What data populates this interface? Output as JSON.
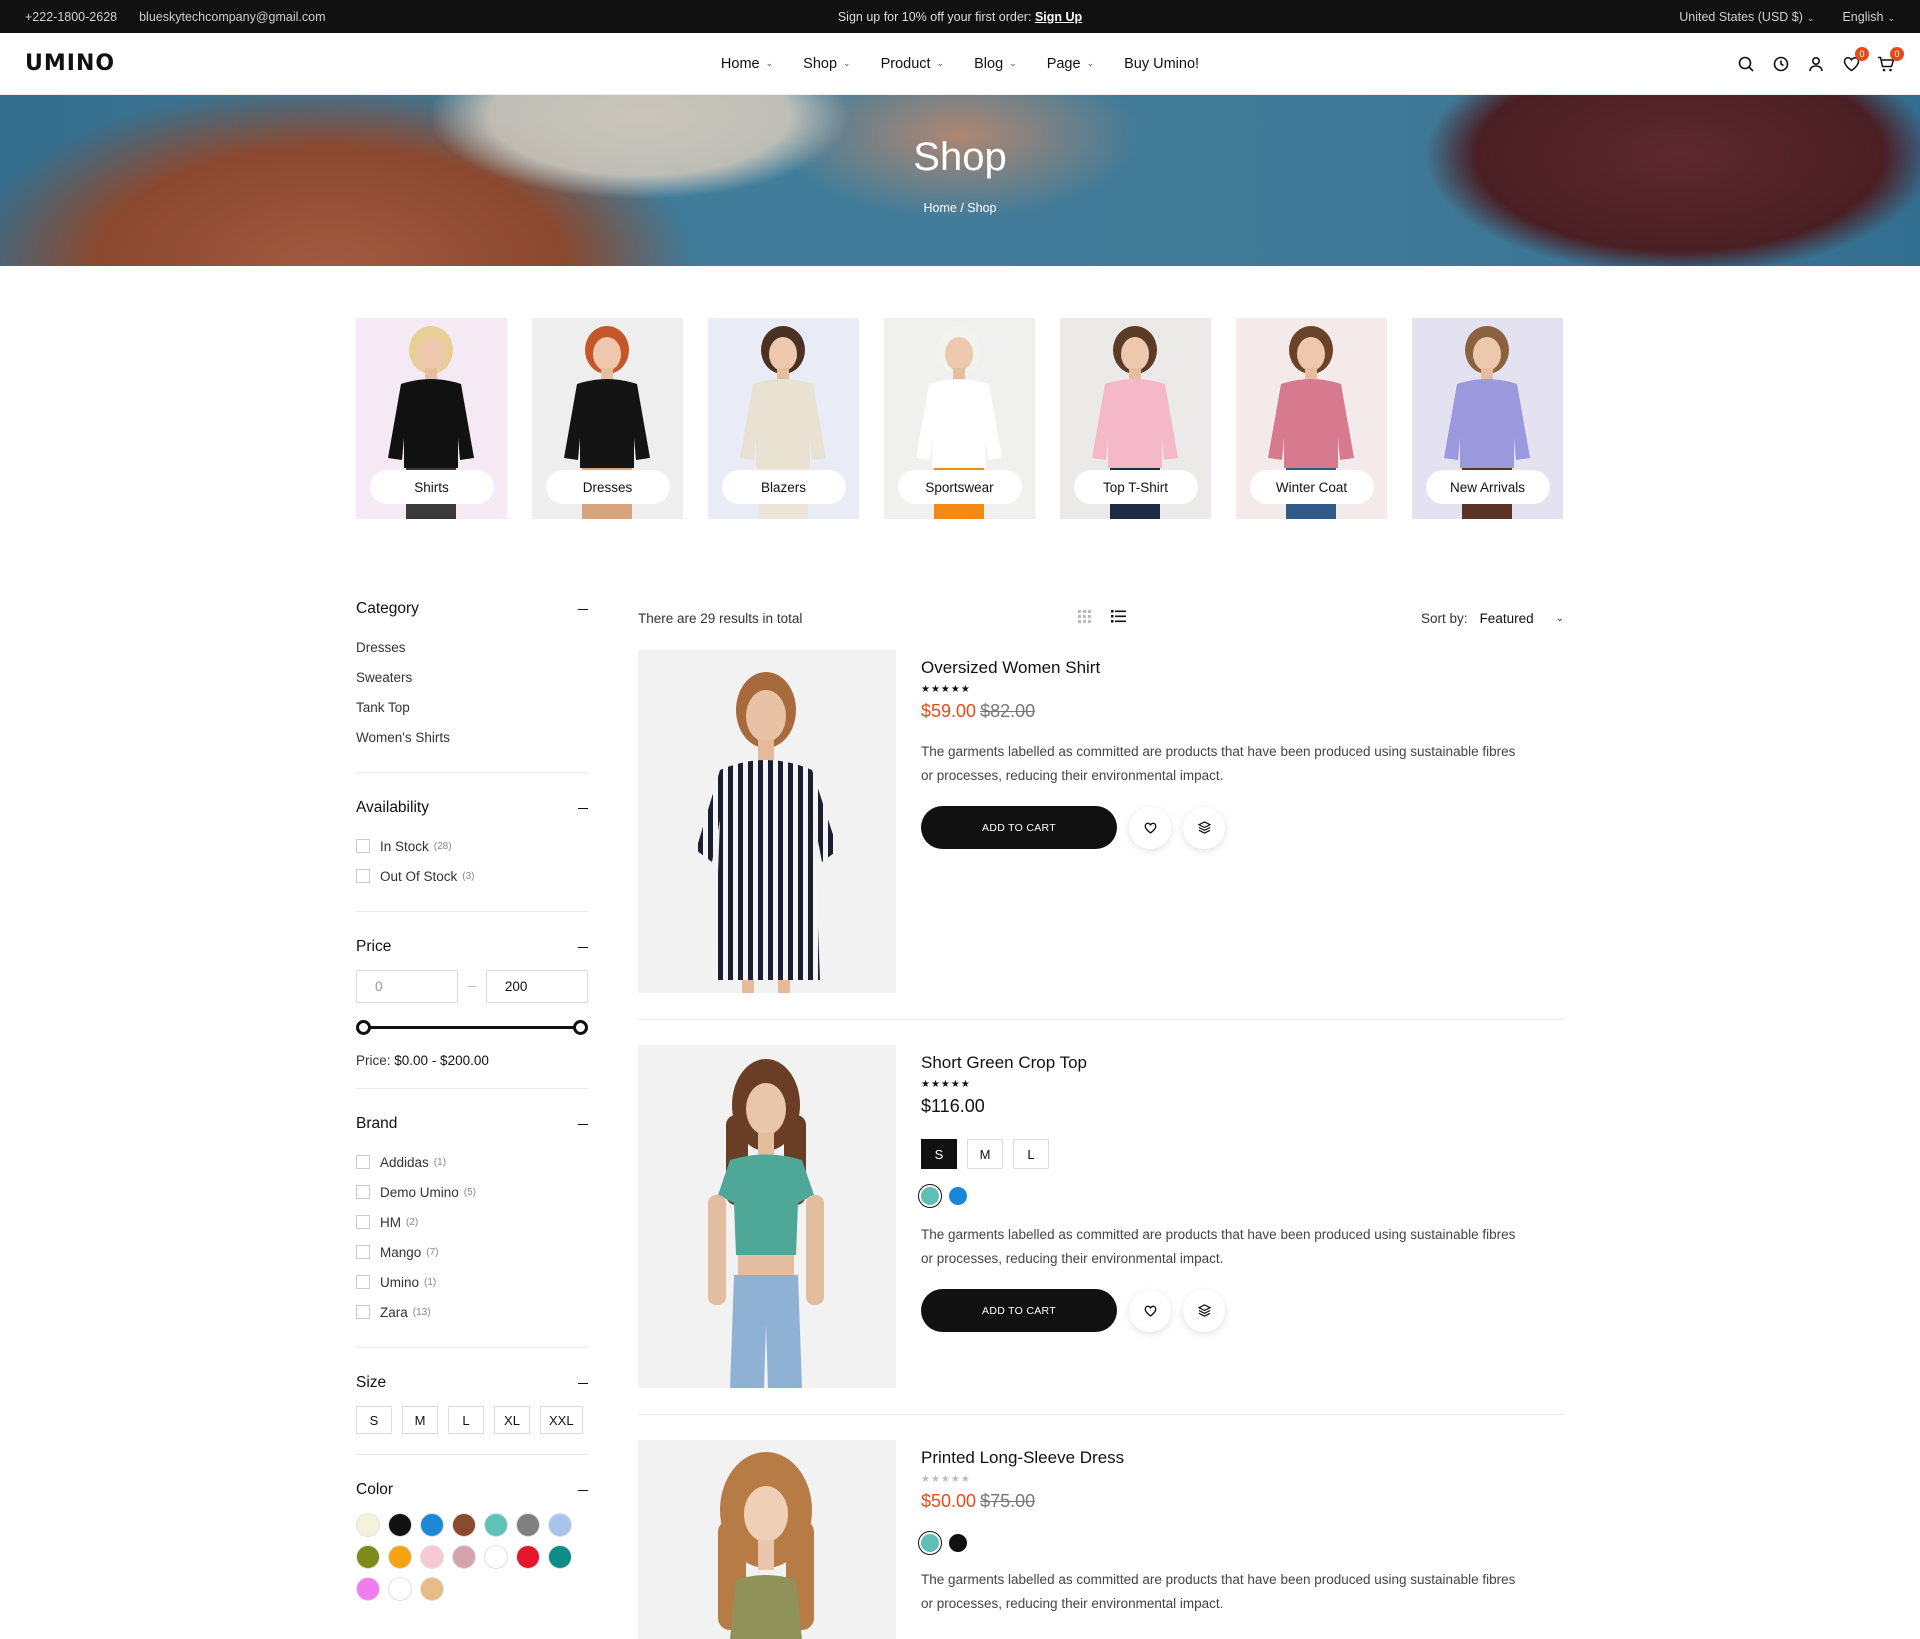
{
  "topbar": {
    "phone": "+222-1800-2628",
    "email": "blueskytechcompany@gmail.com",
    "promo_text": "Sign up for 10% off your first order:",
    "promo_link": "Sign Up",
    "currency": "United States (USD $)",
    "language": "English"
  },
  "header": {
    "logo": "UMINO",
    "nav": [
      {
        "label": "Home"
      },
      {
        "label": "Shop"
      },
      {
        "label": "Product"
      },
      {
        "label": "Blog"
      },
      {
        "label": "Page"
      },
      {
        "label": "Buy Umino!"
      }
    ],
    "wishlist_count": "0",
    "cart_count": "0"
  },
  "hero": {
    "title": "Shop",
    "breadcrumb": "Home / Shop"
  },
  "categories": [
    {
      "label": "Shirts",
      "bg": "#f5eaf3"
    },
    {
      "label": "Dresses",
      "bg": "#eeeeee"
    },
    {
      "label": "Blazers",
      "bg": "#e9ecf6"
    },
    {
      "label": "Sportswear",
      "bg": "#f0f0ef"
    },
    {
      "label": "Top T-Shirt",
      "bg": "#eceae8"
    },
    {
      "label": "Winter Coat",
      "bg": "#f4eaea"
    },
    {
      "label": "New Arrivals",
      "bg": "#e4e2f1"
    }
  ],
  "filters": {
    "category": {
      "title": "Category",
      "items": [
        "Dresses",
        "Sweaters",
        "Tank Top",
        "Women's Shirts"
      ]
    },
    "availability": {
      "title": "Availability",
      "items": [
        {
          "label": "In Stock",
          "count": "(28)"
        },
        {
          "label": "Out Of Stock",
          "count": "(3)"
        }
      ]
    },
    "price": {
      "title": "Price",
      "min_value": "0",
      "max_value": "200",
      "range_label": "Price:",
      "range_value": "$0.00 - $200.00"
    },
    "brand": {
      "title": "Brand",
      "items": [
        {
          "label": "Addidas",
          "count": "(1)"
        },
        {
          "label": "Demo Umino",
          "count": "(5)"
        },
        {
          "label": "HM",
          "count": "(2)"
        },
        {
          "label": "Mango",
          "count": "(7)"
        },
        {
          "label": "Umino",
          "count": "(1)"
        },
        {
          "label": "Zara",
          "count": "(13)"
        }
      ]
    },
    "size": {
      "title": "Size",
      "items": [
        "S",
        "M",
        "L",
        "XL",
        "XXL"
      ]
    },
    "color": {
      "title": "Color",
      "swatches": [
        "#f5f2dc",
        "#111111",
        "#1e88d6",
        "#8b4a2e",
        "#5ec2b7",
        "#808080",
        "#a7c4ea",
        "#7f8a1a",
        "#f7a313",
        "#f8c9d6",
        "#d4a3ae",
        "#ffffff",
        "#e3162c",
        "#0d8b86",
        "#f07cf0",
        "#ffffff",
        "#e6bd85"
      ]
    }
  },
  "toolbar": {
    "results": "There are 29 results in total",
    "sort_label": "Sort by:",
    "sort_value": "Featured"
  },
  "products": [
    {
      "title": "Oversized Women Shirt",
      "stars": "★★★★★",
      "price_sale": "$59.00",
      "price_old": "$82.00",
      "description": "The garments labelled as committed are products that have been produced using sustainable fibres or processes, reducing their environmental impact.",
      "cart_label": "ADD TO CART"
    },
    {
      "title": "Short Green Crop Top",
      "stars": "★★★★★",
      "price": "$116.00",
      "sizes": [
        "S",
        "M",
        "L"
      ],
      "colors": [
        "#5fbfb4",
        "#1a86d8"
      ],
      "description": "The garments labelled as committed are products that have been produced using sustainable fibres or processes, reducing their environmental impact.",
      "cart_label": "ADD TO CART"
    },
    {
      "title": "Printed Long-Sleeve Dress",
      "stars": "★★★★★",
      "price_sale": "$50.00",
      "price_old": "$75.00",
      "colors": [
        "#5fbfb4",
        "#111111"
      ],
      "description": "The garments labelled as committed are products that have been produced using sustainable fibres or processes, reducing their environmental impact."
    }
  ]
}
